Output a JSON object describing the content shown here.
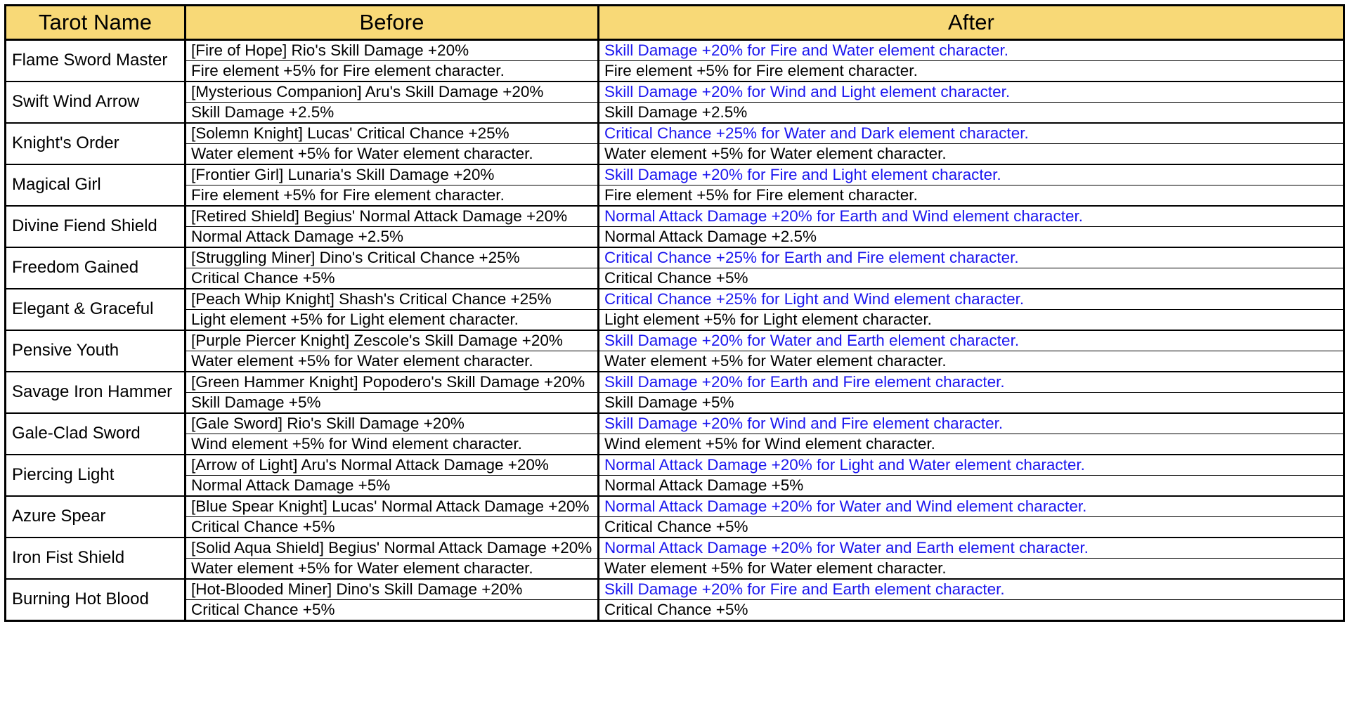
{
  "table": {
    "headers": {
      "name": "Tarot Name",
      "before": "Before",
      "after": "After"
    },
    "header_bg_color": "#F8D977",
    "highlight_color": "#1b16ef",
    "text_color": "#000000",
    "border_color": "#000000",
    "rows": [
      {
        "name": "Flame Sword Master",
        "before_line1": "[Fire of Hope] Rio's Skill Damage +20%",
        "before_line2": "Fire element +5% for Fire element character.",
        "after_line1": "Skill Damage +20% for Fire and Water element character.",
        "after_line2": "Fire element +5% for Fire element character."
      },
      {
        "name": "Swift Wind Arrow",
        "before_line1": "[Mysterious Companion] Aru's Skill Damage +20%",
        "before_line2": "Skill Damage +2.5%",
        "after_line1": "Skill Damage +20% for Wind and Light element character.",
        "after_line2": "Skill Damage +2.5%"
      },
      {
        "name": "Knight's Order",
        "before_line1": "[Solemn Knight] Lucas' Critical Chance +25%",
        "before_line2": "Water element +5% for Water element character.",
        "after_line1": "Critical Chance +25% for Water and Dark element character.",
        "after_line2": "Water element +5% for Water element character."
      },
      {
        "name": "Magical Girl",
        "before_line1": "[Frontier Girl] Lunaria's Skill Damage +20%",
        "before_line2": "Fire element +5% for Fire element character.",
        "after_line1": "Skill Damage +20% for Fire and Light element character.",
        "after_line2": "Fire element +5% for Fire element character."
      },
      {
        "name": "Divine Fiend Shield",
        "before_line1": "[Retired Shield] Begius' Normal Attack Damage +20%",
        "before_line2": "Normal Attack Damage +2.5%",
        "after_line1": "Normal Attack Damage +20% for Earth and Wind element character.",
        "after_line2": "Normal Attack Damage +2.5%"
      },
      {
        "name": "Freedom Gained",
        "before_line1": "[Struggling Miner] Dino's Critical Chance +25%",
        "before_line2": "Critical Chance +5%",
        "after_line1": "Critical Chance +25% for Earth and Fire element character.",
        "after_line2": "Critical Chance +5%"
      },
      {
        "name": "Elegant & Graceful",
        "before_line1": "[Peach Whip Knight] Shash's Critical Chance +25%",
        "before_line2": "Light element +5% for Light element character.",
        "after_line1": "Critical Chance +25% for Light and Wind element character.",
        "after_line2": "Light element +5% for Light element character."
      },
      {
        "name": "Pensive Youth",
        "before_line1": "[Purple Piercer Knight] Zescole's Skill Damage +20%",
        "before_line2": "Water element +5% for Water element character.",
        "after_line1": "Skill Damage +20% for Water and Earth element character.",
        "after_line2": "Water element +5% for Water element character."
      },
      {
        "name": "Savage Iron Hammer",
        "before_line1": "[Green Hammer Knight] Popodero's Skill Damage +20%",
        "before_line2": "Skill Damage +5%",
        "after_line1": "Skill Damage +20% for Earth and Fire element character.",
        "after_line2": "Skill Damage +5%"
      },
      {
        "name": "Gale-Clad Sword",
        "before_line1": "[Gale Sword] Rio's Skill Damage +20%",
        "before_line2": "Wind element +5% for Wind element character.",
        "after_line1": "Skill Damage +20% for Wind and Fire element character.",
        "after_line2": "Wind element +5% for Wind element character."
      },
      {
        "name": "Piercing Light",
        "before_line1": "[Arrow of Light] Aru's Normal Attack Damage +20%",
        "before_line2": "Normal Attack Damage +5%",
        "after_line1": "Normal Attack Damage +20% for Light and Water element character.",
        "after_line2": "Normal Attack Damage +5%"
      },
      {
        "name": "Azure Spear",
        "before_line1": "[Blue Spear Knight] Lucas' Normal Attack Damage +20%",
        "before_line2": "Critical Chance +5%",
        "after_line1": "Normal Attack Damage +20% for Water and Wind element character.",
        "after_line2": "Critical Chance +5%"
      },
      {
        "name": "Iron Fist Shield",
        "before_line1": "[Solid Aqua Shield] Begius' Normal Attack Damage +20%",
        "before_line2": "Water element +5% for Water element character.",
        "after_line1": "Normal Attack Damage +20% for Water and Earth element character.",
        "after_line2": "Water element +5% for Water element character."
      },
      {
        "name": "Burning Hot Blood",
        "before_line1": "[Hot-Blooded Miner] Dino's Skill Damage +20%",
        "before_line2": "Critical Chance +5%",
        "after_line1": "Skill Damage +20% for Fire and Earth element character.",
        "after_line2": "Critical Chance +5%"
      }
    ]
  }
}
